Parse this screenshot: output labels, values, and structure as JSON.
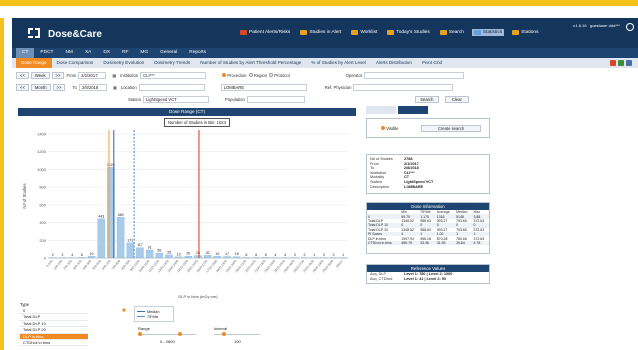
{
  "app": {
    "brand": "Dose&Care",
    "version": "v.1.6.16",
    "user": "guestuser ddd***"
  },
  "top_nav": [
    {
      "label": "Patient Alerts/Risks",
      "icon": "folder-red-icon"
    },
    {
      "label": "Studies in Alert",
      "icon": "folder-icon"
    },
    {
      "label": "Worklist",
      "icon": "folder-icon"
    },
    {
      "label": "Today's Studies",
      "icon": "folder-icon"
    },
    {
      "label": "Search",
      "icon": "folder-icon"
    },
    {
      "label": "Statistics",
      "icon": "chart-icon",
      "active": true
    },
    {
      "label": "Stations",
      "icon": "station-icon"
    }
  ],
  "modules": [
    "CT",
    "PDCT",
    "NM",
    "XA",
    "DX",
    "RF",
    "MG",
    "General",
    "Reports"
  ],
  "active_module": "CT",
  "subtabs": [
    "Dose Range",
    "Dose Comparison",
    "Dosimetry Evolution",
    "Dosimetry Trends",
    "Number of Studies by Alert Threshold Percentage",
    "% of Studies by Alert Level",
    "Alerts Distribution",
    "Pivot Grid"
  ],
  "active_subtab": "Dose Range",
  "filters": {
    "week_btn": "Week",
    "month_btn": "Month",
    "from_label": "From",
    "from_value": "2/1/2017",
    "to_label": "To",
    "to_value": "2/8/2018",
    "institution_label": "Institution",
    "institution_value": "CLI***",
    "location_label": "Location",
    "location_value": "",
    "station_label": "Station",
    "station_value": "LightSpeed VCT",
    "procedure_opt": "Procedure",
    "region_opt": "Region",
    "protocol_opt": "Protocol",
    "procedure_value": "LOMBARE",
    "population_label": "Population",
    "population_value": "",
    "operator_label": "Operator",
    "operator_value": "",
    "ref_phys_label": "Ref. Physician",
    "ref_phys_value": "",
    "search_btn": "Search",
    "clear_btn": "Clear"
  },
  "chart_panel": {
    "header": "Dose Range (CT)",
    "tooltip": "Number of Studies in Bin: 1024"
  },
  "chart_data": {
    "type": "bar",
    "title": "Dose Range (CT)",
    "ylabel": "N# of Studies",
    "xlabel": "DLP in bins (mGy·cm)",
    "ylim": [
      0,
      1400
    ],
    "yticks": [
      0,
      200,
      400,
      600,
      800,
      1000,
      1200,
      1400
    ],
    "categories": [
      "0-100",
      "100-200",
      "200-300",
      "300-400",
      "400-500",
      "500-600",
      "600-700",
      "700-800",
      "800-900",
      "900-1000",
      "1000-1100",
      "1100-1200",
      "1200-1300",
      "1300-1400",
      "1400-1500",
      "1500-1600",
      "1600-1700",
      "1700-1800",
      "1800-1900",
      "1900-2000",
      "2000-2100",
      "2100-2200",
      "2200-2300",
      "2300-2400",
      "2400-2500",
      "2500-2600",
      "2600-2700",
      "2700-2800",
      "2800-2900",
      "2900-3000",
      "3000+"
    ],
    "values": [
      2,
      2,
      4,
      6,
      19,
      443,
      1024,
      460,
      171,
      117,
      91,
      56,
      35,
      13,
      20,
      28,
      30,
      19,
      17,
      15,
      6,
      6,
      6,
      4,
      4,
      3,
      2,
      1,
      3,
      3,
      1
    ],
    "value_labels": [
      "2",
      "2",
      "4",
      "6",
      "19",
      "443",
      "1024",
      "460",
      "171",
      "117",
      "91",
      "56",
      "35",
      "13",
      "20",
      "28",
      "30",
      "19",
      "17",
      "15",
      "6",
      "6",
      "6",
      "4",
      "4",
      "3",
      "2",
      "1",
      "3",
      "3",
      "1"
    ],
    "markers": [
      {
        "name": "Median",
        "category_index": 6.3,
        "color": "#3a6fb4",
        "style": "solid"
      },
      {
        "name": "75% ref",
        "category_index": 8.4,
        "color": "#5a8fcf",
        "style": "dashed"
      },
      {
        "name": "Threshold",
        "category_index": 15.1,
        "color": "#d9472b",
        "style": "solid"
      },
      {
        "name": "Alert",
        "category_index": 5.8,
        "color": "#f1a64a",
        "style": "solid"
      }
    ],
    "bar_color": "#a8cbe9",
    "grid": true
  },
  "right_panel": {
    "tab1": "",
    "tab2": "",
    "visible_label": "Visible",
    "create_btn": "Create search",
    "summary": [
      {
        "k": "N# of Studies",
        "v": "2788"
      },
      {
        "k": "From",
        "v": "2/1/2017"
      },
      {
        "k": "To",
        "v": "2/8/2018"
      },
      {
        "k": "Institution",
        "v": "CLI***"
      },
      {
        "k": "Modality",
        "v": "CT"
      },
      {
        "k": "Station",
        "v": "LightSpeed VCT"
      },
      {
        "k": "Description",
        "v": "LOMBARE"
      }
    ],
    "dose_header": "Dose Information",
    "dose_cols": [
      "",
      "Min",
      "75%ile",
      "Average",
      "Median",
      "Max"
    ],
    "dose_rows": [
      [
        "0",
        "95.75",
        "1.175",
        "1318",
        "5148",
        "3.88"
      ],
      [
        "Total DLP",
        "1348.52",
        "988.63",
        "993.27",
        "793.65",
        "372.63"
      ],
      [
        "Total DLP 10",
        "0",
        "0",
        "0",
        "0",
        "0"
      ],
      [
        "Total DLP 20",
        "1348.52",
        "988.63",
        "993.27",
        "793.65",
        "372.63"
      ],
      [
        "PI Scans",
        "4",
        "1",
        "1.02",
        "1",
        "1"
      ],
      [
        "DLP in bins",
        "1997.94",
        "956.18",
        "870.28",
        "780.65",
        "372.63"
      ],
      [
        "CTDIvol in bins",
        "489.79",
        "33.96",
        "31.95",
        "26.84",
        "4.78"
      ]
    ],
    "ref_header": "Reference Values",
    "refs": [
      {
        "k": "Acq. DLP",
        "v": "Level 1: 780 | Level 2: 1000"
      },
      {
        "k": "Acq. CTDIvol",
        "v": "Level 1: 41 | Level 2: 50"
      }
    ]
  },
  "bottom": {
    "type_label": "Type",
    "types": [
      "0",
      "Total DLP",
      "Total DLP 10",
      "Total DLP 20",
      "DLP in bins",
      "CTDIvol in bins"
    ],
    "active_type": "DLP in bins",
    "legend": [
      {
        "label": "Median",
        "color": "#3a6fb4"
      },
      {
        "label": "75%ile",
        "color": "#5a8fcf"
      }
    ],
    "range_label": "Range",
    "range_value": "0 - 2800",
    "interval_label": "Interval",
    "interval_value": "100"
  }
}
